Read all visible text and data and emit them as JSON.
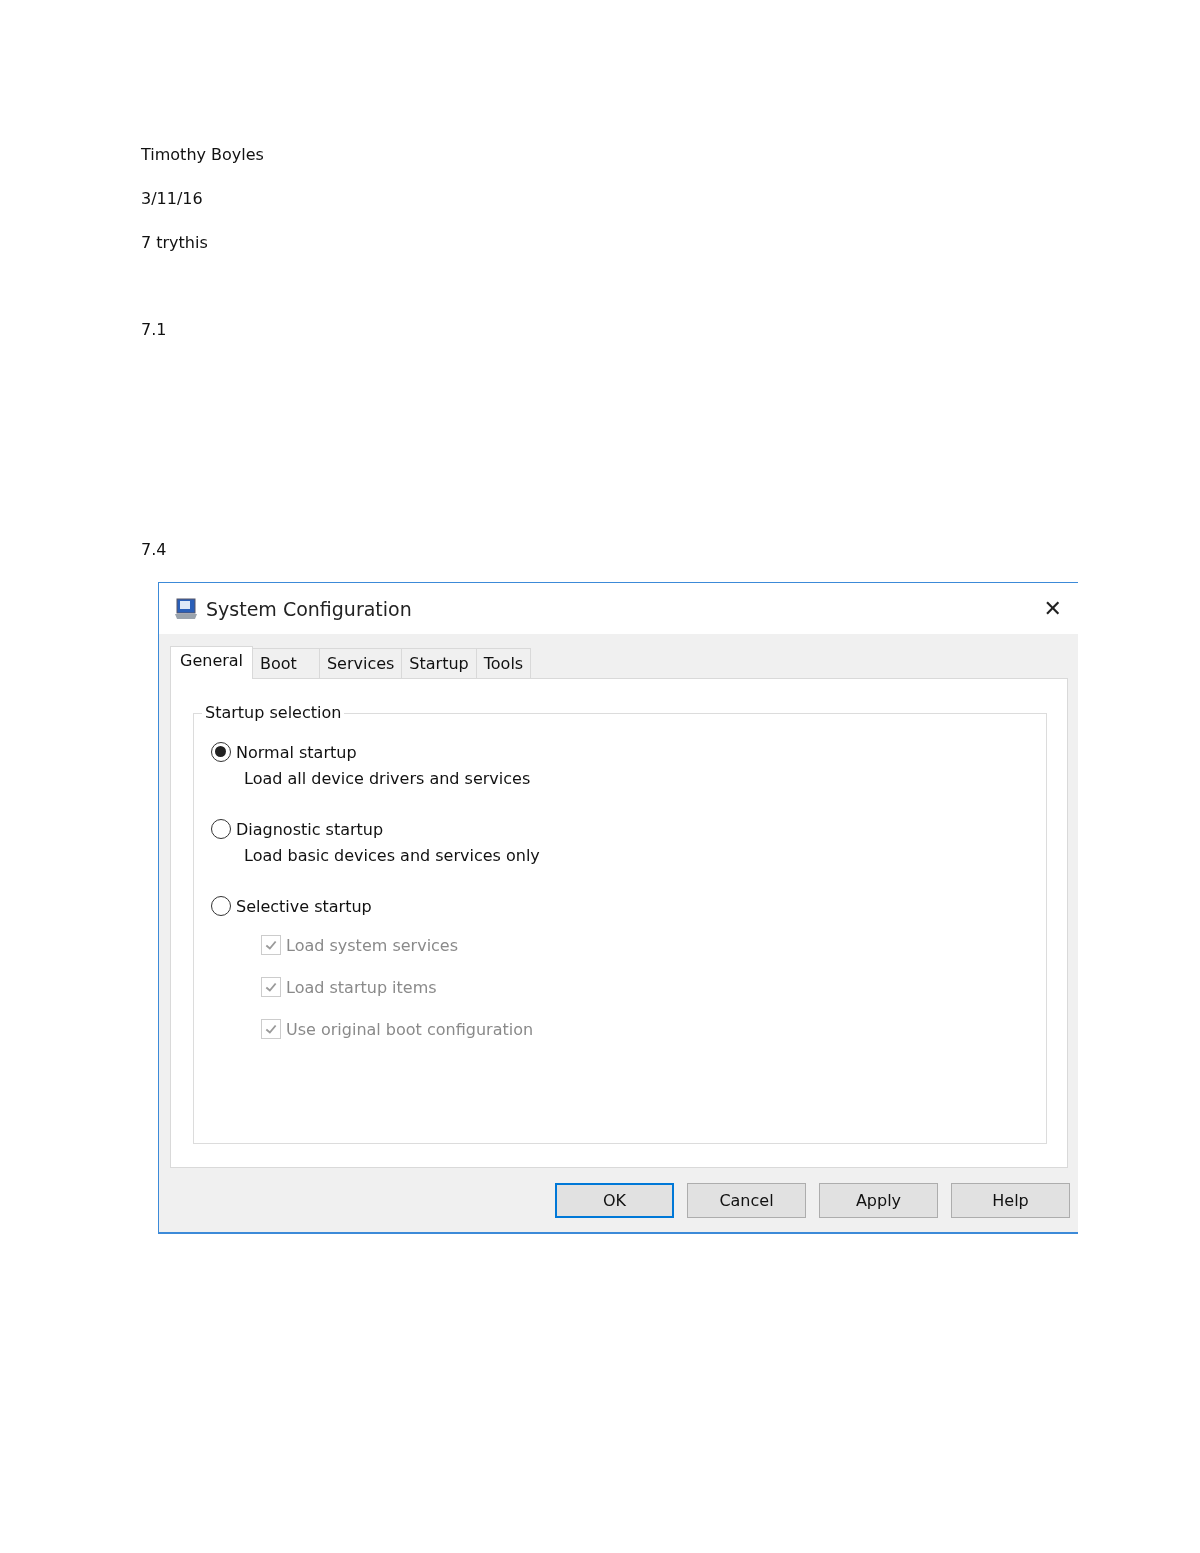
{
  "document": {
    "lines": [
      "Timothy Boyles",
      "3/11/16",
      "7 trythis"
    ],
    "sections": [
      {
        "heading": "7.1"
      },
      {
        "heading": "7.4"
      }
    ]
  },
  "dialog": {
    "title": "System Configuration",
    "close": "✕",
    "tabs": [
      {
        "label": "General",
        "selected": true
      },
      {
        "label": "Boot",
        "selected": false
      },
      {
        "label": "Services",
        "selected": false
      },
      {
        "label": "Startup",
        "selected": false
      },
      {
        "label": "Tools",
        "selected": false
      }
    ],
    "group_title": "Startup selection",
    "options": [
      {
        "label": "Normal startup",
        "description": "Load all device drivers and services",
        "selected": true
      },
      {
        "label": "Diagnostic startup",
        "description": "Load basic devices and services only",
        "selected": false
      },
      {
        "label": "Selective startup",
        "selected": false
      }
    ],
    "checkboxes": [
      {
        "label": "Load system services",
        "checked": true,
        "disabled": true
      },
      {
        "label": "Load startup items",
        "checked": true,
        "disabled": true
      },
      {
        "label": "Use original boot configuration",
        "checked": true,
        "disabled": true
      }
    ],
    "buttons": [
      {
        "label": "OK",
        "default": true
      },
      {
        "label": "Cancel",
        "default": false
      },
      {
        "label": "Apply",
        "default": false
      },
      {
        "label": "Help",
        "default": false
      }
    ]
  }
}
